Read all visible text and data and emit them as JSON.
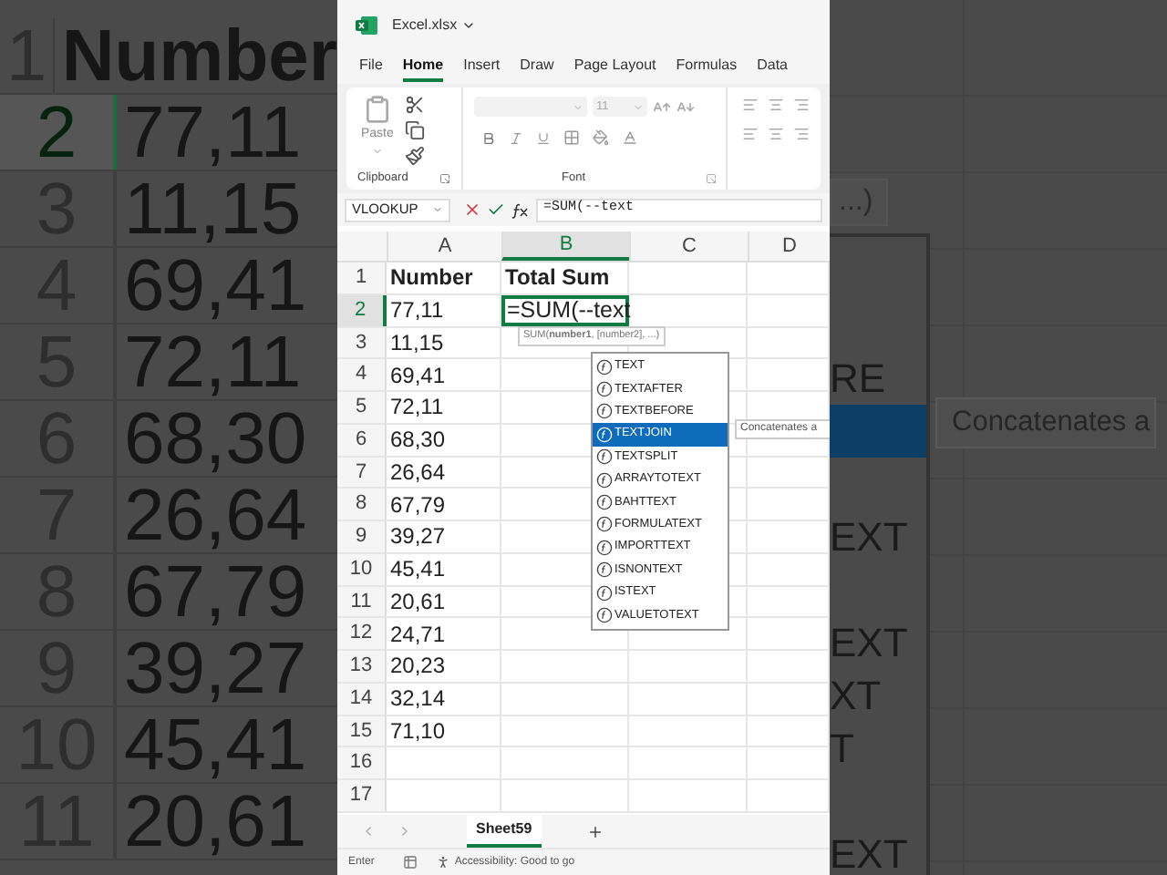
{
  "left_zoom": {
    "rows": [
      {
        "label": "1",
        "value": "Number",
        "kind": "header",
        "selected": false
      },
      {
        "label": "2",
        "value": "77,11",
        "kind": "number",
        "selected": true
      },
      {
        "label": "3",
        "value": "11,15",
        "kind": "number",
        "selected": false
      },
      {
        "label": "4",
        "value": "69,41",
        "kind": "number",
        "selected": false
      },
      {
        "label": "5",
        "value": "72,11",
        "kind": "number",
        "selected": false
      },
      {
        "label": "6",
        "value": "68,30",
        "kind": "number",
        "selected": false
      },
      {
        "label": "7",
        "value": "26,64",
        "kind": "number",
        "selected": false
      },
      {
        "label": "8",
        "value": "67,79",
        "kind": "number",
        "selected": false
      },
      {
        "label": "9",
        "value": "39,27",
        "kind": "number",
        "selected": false
      },
      {
        "label": "10",
        "value": "45,41",
        "kind": "number",
        "selected": false
      },
      {
        "label": "11",
        "value": "20,61",
        "kind": "number",
        "selected": false
      }
    ]
  },
  "excel": {
    "title": "Excel.xlsx",
    "tabs": [
      {
        "label": "File",
        "selected": false
      },
      {
        "label": "Home",
        "selected": true
      },
      {
        "label": "Insert",
        "selected": false
      },
      {
        "label": "Draw",
        "selected": false
      },
      {
        "label": "Page Layout",
        "selected": false
      },
      {
        "label": "Formulas",
        "selected": false
      },
      {
        "label": "Data",
        "selected": false
      }
    ],
    "ribbon": {
      "paste_label": "Paste",
      "font_size": "11",
      "groups": [
        "Clipboard",
        "Font"
      ]
    },
    "formula_bar": {
      "name_box": "VLOOKUP",
      "formula": "=SUM(--text"
    },
    "columns": [
      {
        "label": "A",
        "selected": false
      },
      {
        "label": "B",
        "selected": true
      },
      {
        "label": "C",
        "selected": false
      },
      {
        "label": "D",
        "selected": false
      }
    ],
    "rows": [
      {
        "label": "1",
        "cells": [
          "Number",
          "Total Sum"
        ],
        "kind": "header",
        "selected": false
      },
      {
        "label": "2",
        "cells": [
          "77,11",
          "=SUM(--text"
        ],
        "kind": "editing",
        "selected": true
      },
      {
        "label": "3",
        "cells": [
          "11,15"
        ],
        "kind": "number",
        "selected": false
      },
      {
        "label": "4",
        "cells": [
          "69,41"
        ],
        "kind": "number",
        "selected": false
      },
      {
        "label": "5",
        "cells": [
          "72,11"
        ],
        "kind": "number",
        "selected": false
      },
      {
        "label": "6",
        "cells": [
          "68,30"
        ],
        "kind": "number",
        "selected": false
      },
      {
        "label": "7",
        "cells": [
          "26,64"
        ],
        "kind": "number",
        "selected": false
      },
      {
        "label": "8",
        "cells": [
          "67,79"
        ],
        "kind": "number",
        "selected": false
      },
      {
        "label": "9",
        "cells": [
          "39,27"
        ],
        "kind": "number",
        "selected": false
      },
      {
        "label": "10",
        "cells": [
          "45,41"
        ],
        "kind": "number",
        "selected": false
      },
      {
        "label": "11",
        "cells": [
          "20,61"
        ],
        "kind": "number",
        "selected": false
      },
      {
        "label": "12",
        "cells": [
          "24,71"
        ],
        "kind": "number",
        "selected": false
      },
      {
        "label": "13",
        "cells": [
          "20,23"
        ],
        "kind": "number",
        "selected": false
      },
      {
        "label": "14",
        "cells": [
          "32,14"
        ],
        "kind": "number",
        "selected": false
      },
      {
        "label": "15",
        "cells": [
          "71,10"
        ],
        "kind": "number",
        "selected": false
      },
      {
        "label": "16",
        "kind": "number",
        "selected": false
      },
      {
        "label": "17",
        "kind": "number",
        "selected": false
      }
    ],
    "hint": "SUM(**number1**, [number2], ...)",
    "suggestions": [
      {
        "label": "TEXT",
        "selected": false
      },
      {
        "label": "TEXTAFTER",
        "selected": false
      },
      {
        "label": "TEXTBEFORE",
        "selected": false
      },
      {
        "label": "TEXTJOIN",
        "selected": true
      },
      {
        "label": "TEXTSPLIT",
        "selected": false
      },
      {
        "label": "ARRAYTOTEXT",
        "selected": false
      },
      {
        "label": "BAHTTEXT",
        "selected": false
      },
      {
        "label": "FORMULATEXT",
        "selected": false
      },
      {
        "label": "IMPORTTEXT",
        "selected": false
      },
      {
        "label": "ISNONTEXT",
        "selected": false
      },
      {
        "label": "ISTEXT",
        "selected": false
      },
      {
        "label": "VALUETOTEXT",
        "selected": false
      }
    ],
    "tooltip": "Concatenates a",
    "sheets": [
      {
        "label": "Sheet59",
        "selected": true
      }
    ],
    "status": {
      "mode": "Enter",
      "accessibility": "Accessibility: Good to go"
    }
  },
  "right_zoom": {
    "hint": "...)",
    "tooltip": "Concatenates a",
    "items": [
      {
        "selected": false
      },
      {
        "selected": false
      },
      {
        "text": "RE",
        "selected": false
      },
      {
        "selected": true
      },
      {
        "selected": false
      },
      {
        "text": "EXT",
        "selected": false
      },
      {
        "selected": false
      },
      {
        "text": "EXT",
        "selected": false
      },
      {
        "text": "XT",
        "selected": false
      },
      {
        "text": "T",
        "selected": false
      },
      {
        "selected": false
      },
      {
        "text": "EXT",
        "selected": false
      }
    ]
  }
}
